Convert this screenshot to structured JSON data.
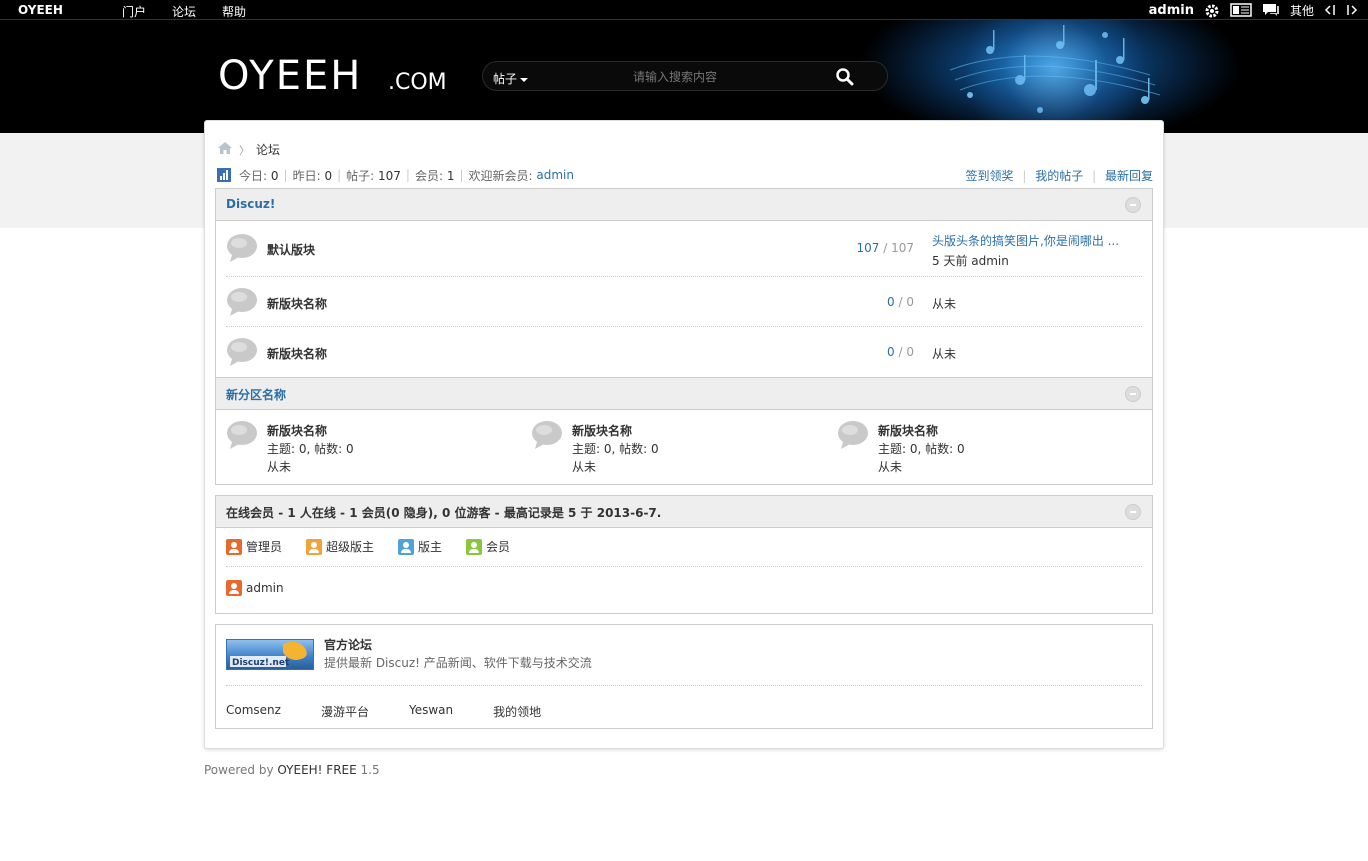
{
  "topbar": {
    "site_name": "OYEEH",
    "nav": [
      "门户",
      "论坛",
      "帮助"
    ],
    "username": "admin",
    "other_label": "其他"
  },
  "header": {
    "logo_text": "OYEEH",
    "logo_suffix": ".COM",
    "search": {
      "type_label": "帖子",
      "placeholder": "请输入搜索内容"
    }
  },
  "breadcrumb": {
    "current": "论坛"
  },
  "stats": {
    "today_label": "今日:",
    "today": "0",
    "yesterday_label": "昨日:",
    "yesterday": "0",
    "posts_label": "帖子:",
    "posts": "107",
    "members_label": "会员:",
    "members": "1",
    "welcome_label": "欢迎新会员:",
    "newest_member": "admin",
    "links": [
      "签到领奖",
      "我的帖子",
      "最新回复"
    ]
  },
  "section1": {
    "title": "Discuz!",
    "forums": [
      {
        "name": "默认版块",
        "threads": "107",
        "posts": "107",
        "last_title": "头版头条的搞笑图片,你是闹哪出 ...",
        "last_meta": "5 天前 admin"
      },
      {
        "name": "新版块名称",
        "threads": "0",
        "posts": "0",
        "last_title": "",
        "last_meta": "从未"
      },
      {
        "name": "新版块名称",
        "threads": "0",
        "posts": "0",
        "last_title": "",
        "last_meta": "从未"
      }
    ],
    "sep": "/"
  },
  "section2": {
    "title": "新分区名称",
    "forums": [
      {
        "name": "新版块名称",
        "stats": "主题: 0, 帖数: 0",
        "last": "从未"
      },
      {
        "name": "新版块名称",
        "stats": "主题: 0, 帖数: 0",
        "last": "从未"
      },
      {
        "name": "新版块名称",
        "stats": "主题: 0, 帖数: 0",
        "last": "从未"
      }
    ]
  },
  "online": {
    "title": "在线会员",
    "summary": " - 1 人在线 - 1 会员(0 隐身), 0 位游客 - 最高记录是 5 于 2013-6-7.",
    "legend": [
      {
        "label": "管理员",
        "color": "#e8692d"
      },
      {
        "label": "超级版主",
        "color": "#f0a33a"
      },
      {
        "label": "版主",
        "color": "#4fa3d9"
      },
      {
        "label": "会员",
        "color": "#8cc63e"
      }
    ],
    "users": [
      {
        "name": "admin",
        "color": "#e8692d"
      }
    ]
  },
  "links": {
    "official_name": "官方论坛",
    "official_desc": "提供最新 Discuz! 产品新闻、软件下载与技术交流",
    "banner_text": "Discuz!.net",
    "items": [
      "Comsenz",
      "漫游平台",
      "Yeswan",
      "我的领地"
    ]
  },
  "footer": {
    "prefix": "Powered by ",
    "product": "OYEEH! FREE",
    "version": " 1.5"
  }
}
